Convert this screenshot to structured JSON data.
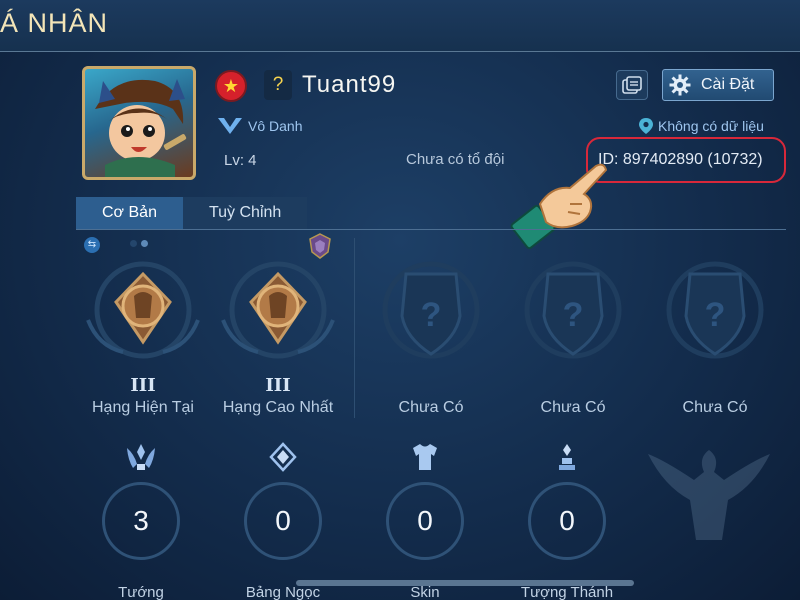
{
  "header": {
    "title": "Á NHÂN"
  },
  "profile": {
    "username": "Tuant99",
    "qmark": "?",
    "rank_title": "Vô Danh",
    "location": "Không có dữ liệu",
    "level": "Lv: 4",
    "team": "Chưa có tổ đội",
    "player_id": "ID: 897402890 (10732)"
  },
  "toolbar": {
    "settings_label": "Cài Đặt"
  },
  "tabs": [
    {
      "label": "Cơ Bản",
      "active": true
    },
    {
      "label": "Tuỳ Chỉnh",
      "active": false
    }
  ],
  "ranks": [
    {
      "roman": "III",
      "label": "Hạng Hiện Tại"
    },
    {
      "roman": "III",
      "label": "Hạng Cao Nhất"
    },
    {
      "roman": "",
      "label": "Chưa Có"
    },
    {
      "roman": "",
      "label": "Chưa Có"
    },
    {
      "roman": "",
      "label": "Chưa Có"
    }
  ],
  "stats": [
    {
      "value": "3",
      "label": "Tướng",
      "icon": "heroes-icon"
    },
    {
      "value": "0",
      "label": "Bảng Ngọc",
      "icon": "arcana-icon"
    },
    {
      "value": "0",
      "label": "Skin",
      "icon": "skin-icon"
    },
    {
      "value": "0",
      "label": "Tượng Thánh",
      "icon": "statue-icon"
    }
  ],
  "colors": {
    "accent_gold": "#c9a96a",
    "highlight_red": "#d8283a",
    "tab_active": "#2d5e8f",
    "text_blue": "#9fc6ef"
  }
}
